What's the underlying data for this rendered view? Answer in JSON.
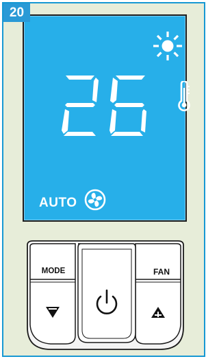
{
  "figure": {
    "number": "20"
  },
  "display": {
    "temperature": "26",
    "mode": "AUTO",
    "icons": {
      "weather": "sun-icon",
      "thermometer": "thermometer-icon",
      "fan": "fan-icon"
    },
    "colors": {
      "screen": "#27afe9",
      "segments": "#ffffff",
      "frame": "#1698d3"
    }
  },
  "buttons": {
    "mode_label": "MODE",
    "fan_label": "FAN",
    "power_icon": "power-icon",
    "down_icon": "triangle-down-minus-icon",
    "up_icon": "triangle-up-plus-icon"
  }
}
